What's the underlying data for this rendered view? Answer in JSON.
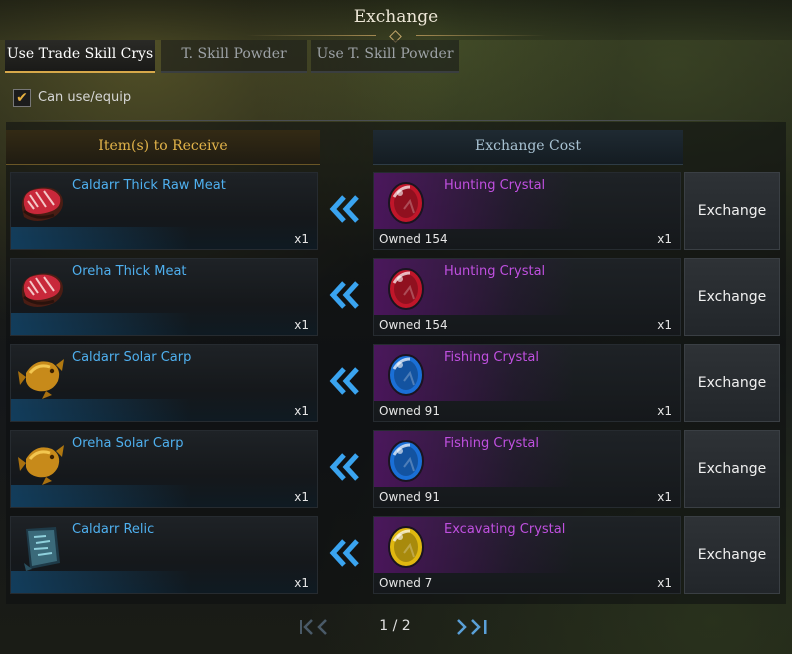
{
  "window": {
    "title": "Exchange"
  },
  "tabs": [
    {
      "label": "Use Trade Skill Crys",
      "active": true
    },
    {
      "label": "T. Skill Powder",
      "active": false
    },
    {
      "label": "Use T. Skill Powder",
      "active": false
    }
  ],
  "filter": {
    "label": "Can use/equip",
    "checked": true
  },
  "headers": {
    "receive": "Item(s) to Receive",
    "cost": "Exchange Cost"
  },
  "rows": [
    {
      "receive": {
        "name": "Caldarr Thick Raw Meat",
        "qty": "x1",
        "icon": "raw-meat-icon"
      },
      "cost": {
        "name": "Hunting Crystal",
        "owned": "Owned 154",
        "qty": "x1",
        "icon": "red-crystal-icon",
        "color": "#c0162a"
      },
      "button": "Exchange"
    },
    {
      "receive": {
        "name": "Oreha Thick Meat",
        "qty": "x1",
        "icon": "raw-meat-icon"
      },
      "cost": {
        "name": "Hunting Crystal",
        "owned": "Owned 154",
        "qty": "x1",
        "icon": "red-crystal-icon",
        "color": "#c0162a"
      },
      "button": "Exchange"
    },
    {
      "receive": {
        "name": "Caldarr Solar Carp",
        "qty": "x1",
        "icon": "golden-carp-icon"
      },
      "cost": {
        "name": "Fishing Crystal",
        "owned": "Owned 91",
        "qty": "x1",
        "icon": "blue-crystal-icon",
        "color": "#1a6fd6"
      },
      "button": "Exchange"
    },
    {
      "receive": {
        "name": "Oreha Solar Carp",
        "qty": "x1",
        "icon": "golden-carp-icon"
      },
      "cost": {
        "name": "Fishing Crystal",
        "owned": "Owned 91",
        "qty": "x1",
        "icon": "blue-crystal-icon",
        "color": "#1a6fd6"
      },
      "button": "Exchange"
    },
    {
      "receive": {
        "name": "Caldarr Relic",
        "qty": "x1",
        "icon": "relic-tablet-icon"
      },
      "cost": {
        "name": "Excavating Crystal",
        "owned": "Owned 7",
        "qty": "x1",
        "icon": "yellow-crystal-icon",
        "color": "#e0b810"
      },
      "button": "Exchange"
    }
  ],
  "pagination": {
    "text": "1 / 2"
  }
}
